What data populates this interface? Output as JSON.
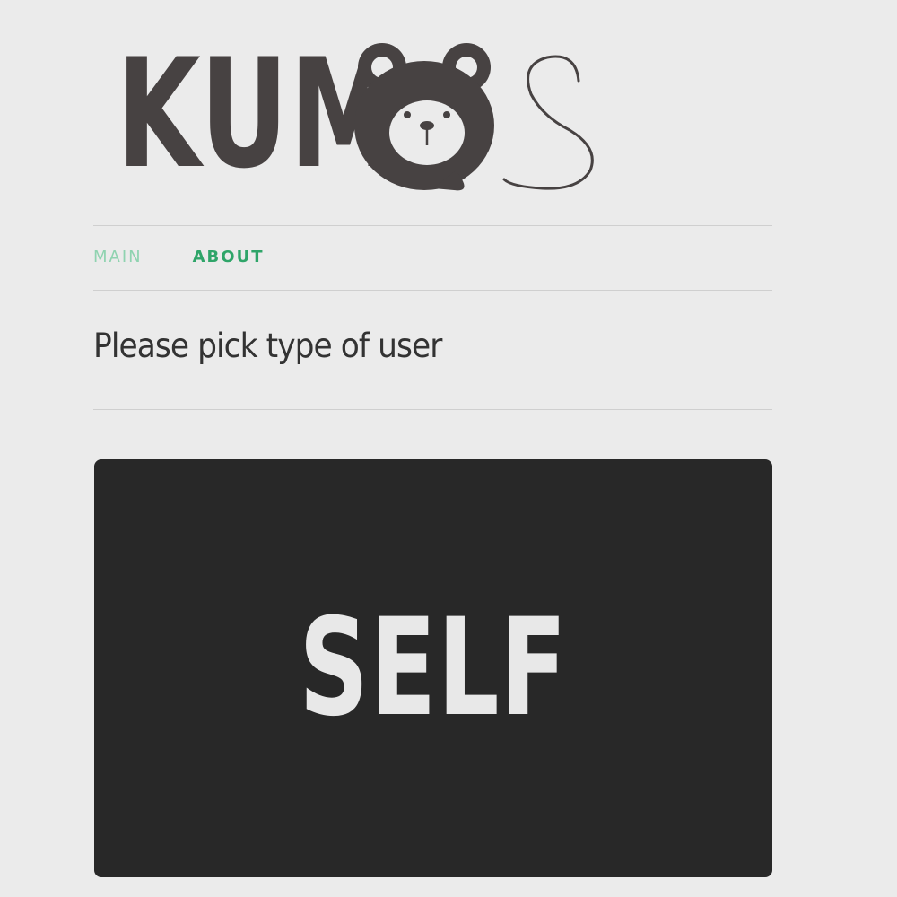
{
  "logo": {
    "text": "KUMOS"
  },
  "nav": {
    "items": [
      {
        "label": "MAIN"
      },
      {
        "label": "ABOUT"
      }
    ]
  },
  "main": {
    "prompt": "Please pick type of user",
    "options": [
      {
        "label": "SELF"
      }
    ]
  },
  "colors": {
    "background": "#ebebeb",
    "logo": "#474242",
    "nav_main": "#8fd3b0",
    "nav_about": "#2fa569",
    "card": "#282828",
    "card_text": "#e8e8e8"
  }
}
